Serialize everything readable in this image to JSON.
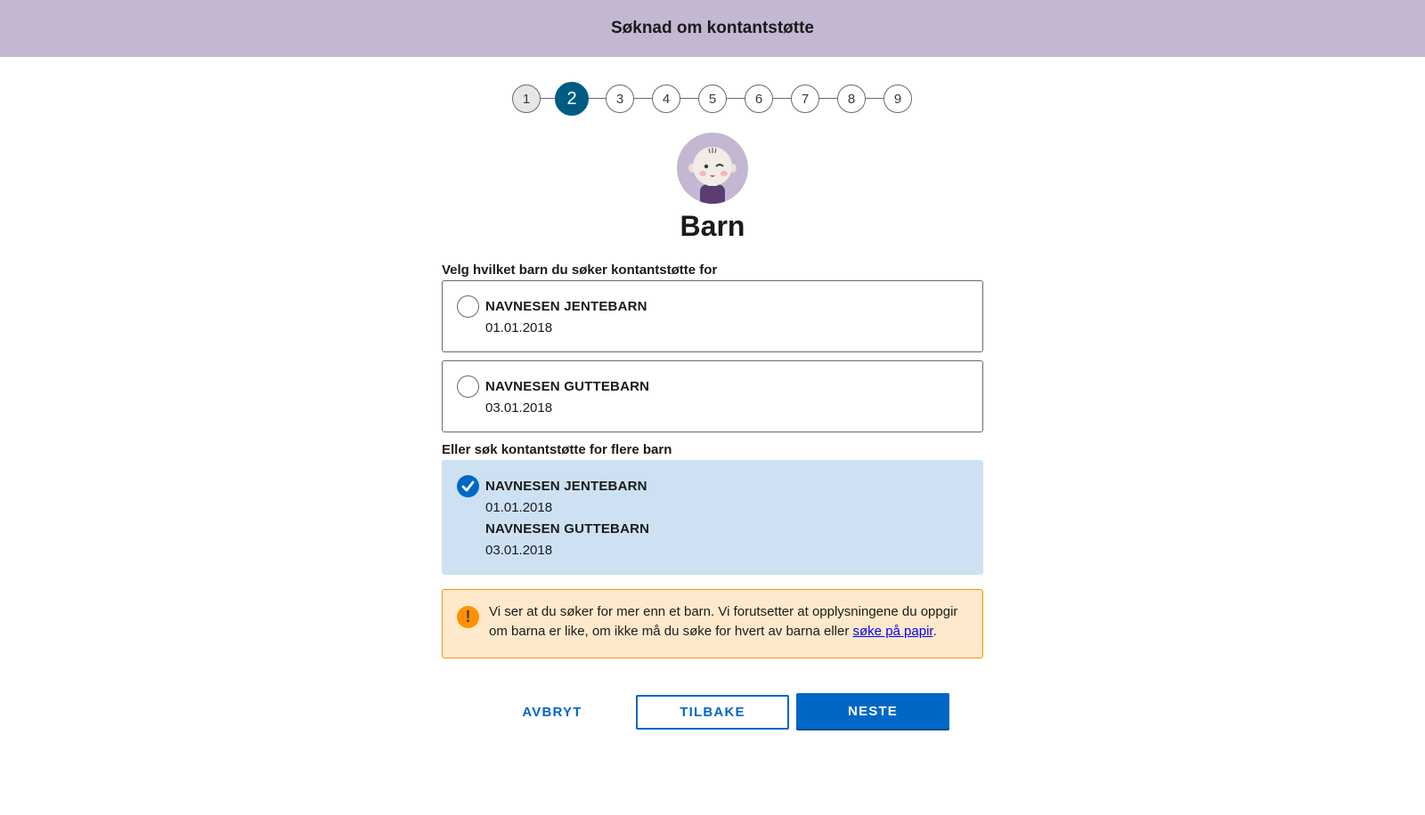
{
  "header": {
    "title": "Søknad om kontantstøtte"
  },
  "stepper": {
    "steps": [
      "1",
      "2",
      "3",
      "4",
      "5",
      "6",
      "7",
      "8",
      "9"
    ],
    "current": 2,
    "colors": {
      "active": "#005b82",
      "done": "#e7e7e7"
    }
  },
  "page": {
    "title": "Barn",
    "avatar_icon": "baby-avatar-icon"
  },
  "single_choice": {
    "label": "Velg hvilket barn du søker kontantstøtte for",
    "options": [
      {
        "name": "NAVNESEN JENTEBARN",
        "dob": "01.01.2018",
        "selected": false
      },
      {
        "name": "NAVNESEN GUTTEBARN",
        "dob": "03.01.2018",
        "selected": false
      }
    ]
  },
  "multi_choice": {
    "label": "Eller søk kontantstøtte for flere barn",
    "selected": true,
    "children": [
      {
        "name": "NAVNESEN JENTEBARN",
        "dob": "01.01.2018"
      },
      {
        "name": "NAVNESEN GUTTEBARN",
        "dob": "03.01.2018"
      }
    ]
  },
  "alert": {
    "icon": "warning-icon",
    "text_before": "Vi ser at du søker for mer enn et barn. Vi forutsetter at opplysningene du oppgir om barna er like, om ikke må du søke for hvert av barna eller ",
    "link": "søke på papir",
    "text_after": ".",
    "colors": {
      "background": "#ffe9cc",
      "border": "#ff9100"
    }
  },
  "buttons": {
    "cancel": "AVBRYT",
    "back": "TILBAKE",
    "next": "NESTE"
  },
  "colors": {
    "banner": "#c4b7d1",
    "primary": "#0067c5",
    "selected_card": "#cde1f3"
  }
}
